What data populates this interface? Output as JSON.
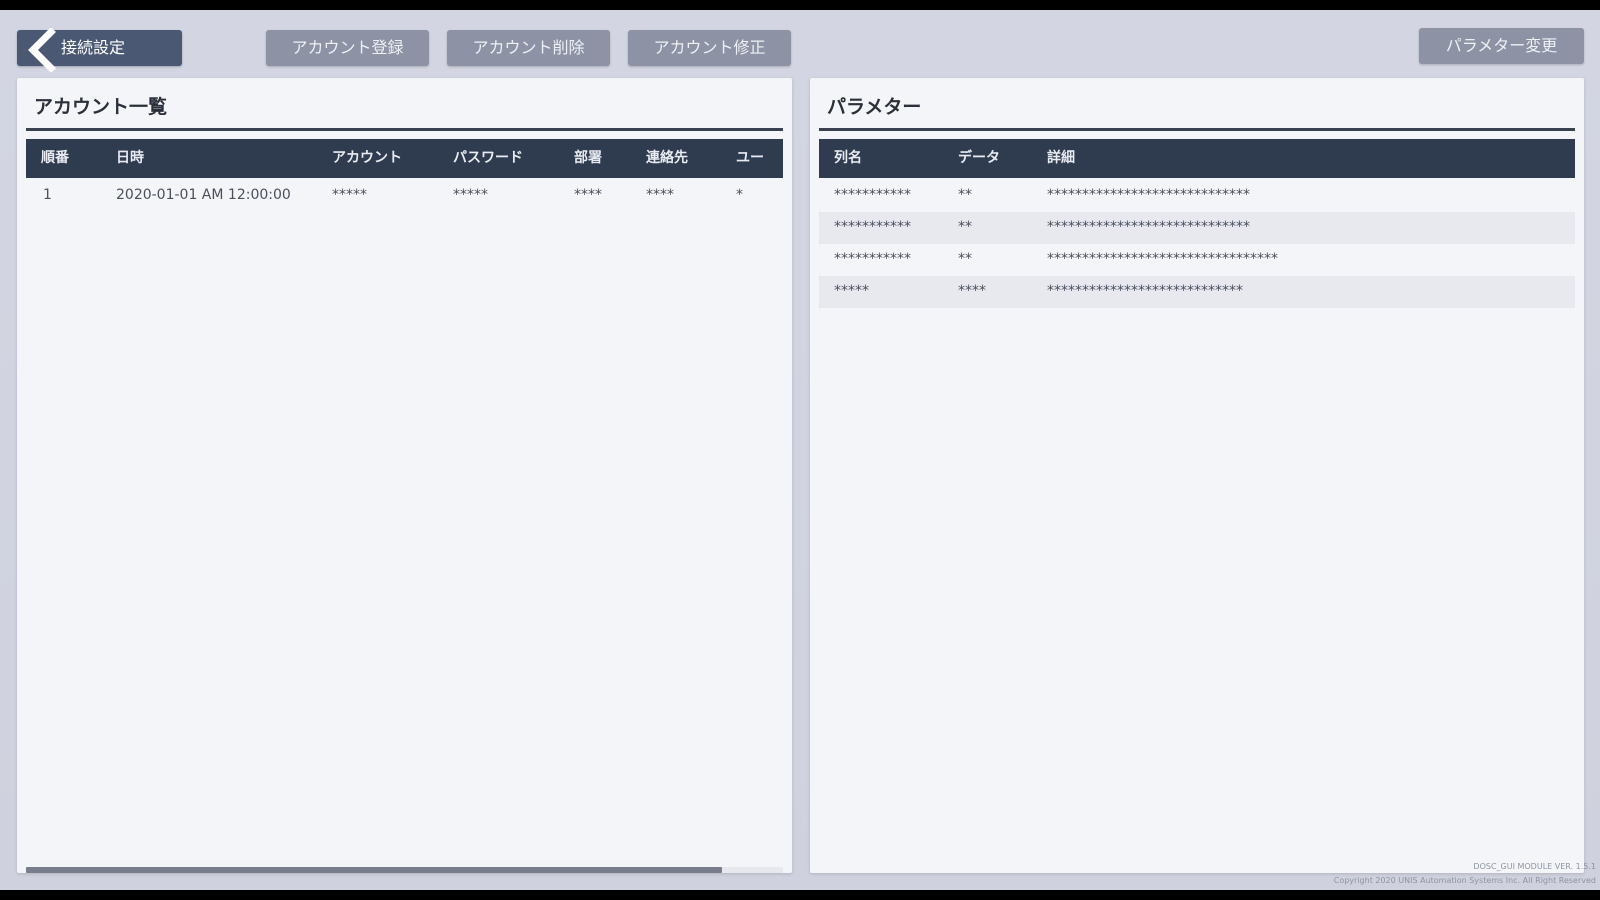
{
  "toolbar": {
    "back_label": "接続設定",
    "register_label": "アカウント登録",
    "delete_label": "アカウント削除",
    "modify_label": "アカウント修正",
    "param_change_label": "パラメター変更"
  },
  "accounts": {
    "title": "アカウント一覧",
    "columns": [
      "順番",
      "日時",
      "アカウント",
      "パスワード",
      "部署",
      "連絡先",
      "ユー"
    ],
    "rows": [
      [
        "1",
        "2020-01-01 AM 12:00:00",
        "*****",
        "*****",
        "****",
        "****",
        "*"
      ]
    ],
    "scroll_position": 0.92
  },
  "parameters": {
    "title": "パラメター",
    "columns": [
      "列名",
      "データ",
      "詳細"
    ],
    "rows": [
      [
        "***********",
        "**",
        "*****************************"
      ],
      [
        "***********",
        "**",
        "*****************************"
      ],
      [
        "***********",
        "**",
        "*********************************"
      ],
      [
        "*****",
        "****",
        "****************************"
      ]
    ]
  },
  "footer": {
    "version": "DOSC_GUI MODULE VER. 1.5.1",
    "copyright": "Copyright  2020 UNIS Automation Systems Inc. All Right Reserved"
  }
}
